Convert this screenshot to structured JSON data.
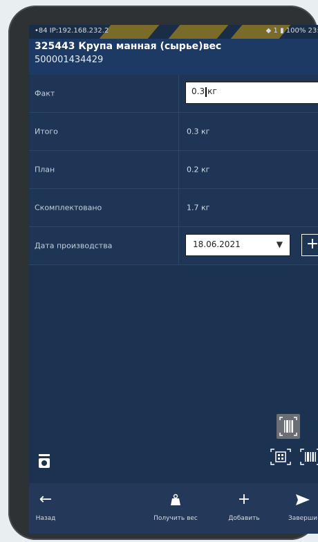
{
  "status_bar": {
    "left_text": "•84 IP:192.168.232.2",
    "right_text": "◆ 1 ▮ 100% 23:1"
  },
  "header": {
    "title": "325443 Крупа манная (сырье)вес",
    "code": "500001434429"
  },
  "rows": [
    {
      "label": "Факт",
      "value": "0.3",
      "unit": "кг"
    },
    {
      "label": "Итого",
      "value": "0.3 кг"
    },
    {
      "label": "План",
      "value": "0.2 кг"
    },
    {
      "label": "Скомплектовано",
      "value": "1.7 кг"
    },
    {
      "label": "Дата производства",
      "value": "18.06.2021"
    }
  ],
  "icons": {
    "scan_single": "barcode-scan-icon",
    "scan_qr": "qr-scan-icon",
    "scan_barcode": "barcode-icon",
    "scales": "scales-icon"
  },
  "bottom_bar": {
    "back": "Назад",
    "get_weight": "Получить вес",
    "add": "Добавить",
    "finish": "Заверши"
  },
  "colors": {
    "background": "#1b3250",
    "header": "#1c3a63",
    "bottom_bar": "#24395a"
  }
}
